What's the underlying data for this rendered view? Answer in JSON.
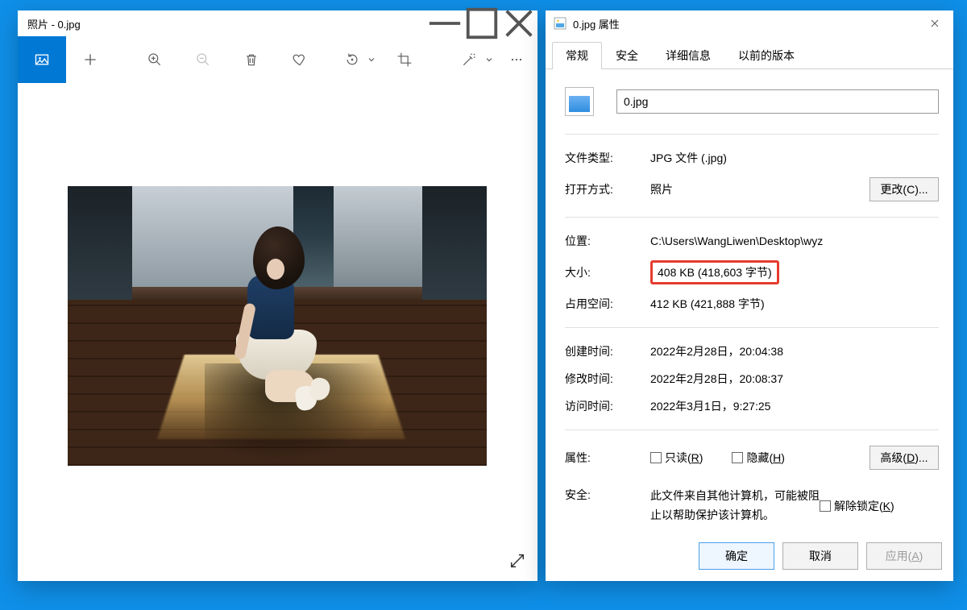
{
  "photos": {
    "title": "照片 - 0.jpg",
    "tools": {
      "view": "view-image",
      "add": "add",
      "zoom_in": "zoom-in",
      "zoom_out": "zoom-out",
      "delete": "delete",
      "favorite": "favorite",
      "info": "info",
      "crop": "crop",
      "edit": "edit",
      "more": "more"
    },
    "expand": "expand-diagonal"
  },
  "props": {
    "title": "0.jpg 属性",
    "tabs": {
      "general": "常规",
      "security": "安全",
      "details": "详细信息",
      "previous": "以前的版本"
    },
    "filename": "0.jpg",
    "rows": {
      "filetype_lbl": "文件类型:",
      "filetype_val": "JPG 文件 (.jpg)",
      "openwith_lbl": "打开方式:",
      "openwith_val": "照片",
      "change_btn": "更改(C)...",
      "location_lbl": "位置:",
      "location_val": "C:\\Users\\WangLiwen\\Desktop\\wyz",
      "size_lbl": "大小:",
      "size_val": "408 KB (418,603 字节)",
      "ondisk_lbl": "占用空间:",
      "ondisk_val": "412 KB (421,888 字节)",
      "created_lbl": "创建时间:",
      "created_val": "2022年2月28日，20:04:38",
      "modified_lbl": "修改时间:",
      "modified_val": "2022年2月28日，20:08:37",
      "accessed_lbl": "访问时间:",
      "accessed_val": "2022年3月1日，9:27:25",
      "attr_lbl": "属性:",
      "readonly_pre": "只读(",
      "readonly_u": "R",
      "readonly_post": ")",
      "hidden_pre": "隐藏(",
      "hidden_u": "H",
      "hidden_post": ")",
      "advanced_pre": "高级(",
      "advanced_u": "D",
      "advanced_post": ")...",
      "sec_lbl": "安全:",
      "sec_note": "此文件来自其他计算机，可能被阻止以帮助保护该计算机。",
      "unblock_pre": "解除锁定(",
      "unblock_u": "K",
      "unblock_post": ")"
    },
    "footer": {
      "ok": "确定",
      "cancel": "取消",
      "apply_pre": "应用(",
      "apply_u": "A",
      "apply_post": ")"
    }
  }
}
